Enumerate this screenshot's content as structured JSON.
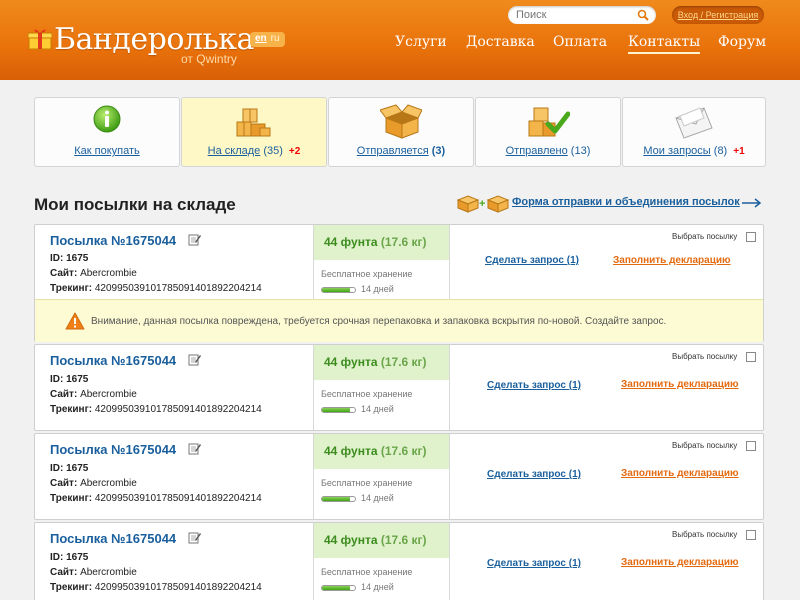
{
  "site": {
    "logo_text": "Бандеролька",
    "logo_subtitle": "от Qwintry",
    "lang_active": "en",
    "lang_other": "ru"
  },
  "header": {
    "search_placeholder": "Поиск",
    "login_label": "Вход / Регистрация",
    "nav": [
      "Услуги",
      "Доставка",
      "Оплата",
      "Контакты",
      "Форум"
    ],
    "nav_active": "Контакты"
  },
  "tabs": [
    {
      "label": "Как покупать",
      "count": "",
      "badge": "",
      "icon": "info-icon"
    },
    {
      "label": "На складе",
      "count": "(35)",
      "badge": "+2",
      "icon": "boxes-icon",
      "active": true
    },
    {
      "label": "Отправляется",
      "count": "(3)",
      "badge": "",
      "icon": "open-box-icon"
    },
    {
      "label": "Отправлено",
      "count": "(13)",
      "badge": "",
      "icon": "boxes-check-icon"
    },
    {
      "label": "Мои запросы",
      "count": "(8)",
      "badge": "+1",
      "icon": "envelope-icon"
    }
  ],
  "section": {
    "title": "Мои посылки на складе",
    "form_link": "Форма отправки и объединения посылок"
  },
  "parcels": [
    {
      "title": "Посылка №1675044",
      "id_label": "ID:",
      "id": "1675",
      "site_label": "Сайт:",
      "site": "Abercrombie",
      "tracking_label": "Трекинг:",
      "tracking": "420995039101785091401892204214",
      "weight_main": "44 фунта",
      "weight_kg": "(17.6 кг)",
      "storage": "Бесплатное хранение",
      "days": "14 дней",
      "storage_progress": 0.85,
      "request": "Сделать запрос (1)",
      "declaration": "Заполнить декларацию",
      "select": "Выбрать посылку",
      "warning": "Внимание, данная посылка повреждена, требуется срочная перепаковка и запаковка вскрытия по-новой. Создайте запрос."
    },
    {
      "title": "Посылка №1675044",
      "id_label": "ID:",
      "id": "1675",
      "site_label": "Сайт:",
      "site": "Abercrombie",
      "tracking_label": "Трекинг:",
      "tracking": "420995039101785091401892204214",
      "weight_main": "44 фунта",
      "weight_kg": "(17.6 кг)",
      "storage": "Бесплатное хранение",
      "days": "14 дней",
      "storage_progress": 0.85,
      "request": "Сделать запрос (1)",
      "declaration": "Заполнить декларацию",
      "select": "Выбрать посылку"
    },
    {
      "title": "Посылка №1675044",
      "id_label": "ID:",
      "id": "1675",
      "site_label": "Сайт:",
      "site": "Abercrombie",
      "tracking_label": "Трекинг:",
      "tracking": "420995039101785091401892204214",
      "weight_main": "44 фунта",
      "weight_kg": "(17.6 кг)",
      "storage": "Бесплатное хранение",
      "days": "14 дней",
      "storage_progress": 0.85,
      "request": "Сделать запрос (1)",
      "declaration": "Заполнить декларацию",
      "select": "Выбрать посылку"
    },
    {
      "title": "Посылка №1675044",
      "id_label": "ID:",
      "id": "1675",
      "site_label": "Сайт:",
      "site": "Abercrombie",
      "tracking_label": "Трекинг:",
      "tracking": "420995039101785091401892204214",
      "weight_main": "44 фунта",
      "weight_kg": "(17.6 кг)",
      "storage": "Бесплатное хранение",
      "days": "14 дней",
      "storage_progress": 0.85,
      "request": "Сделать запрос (1)",
      "declaration": "Заполнить декларацию",
      "select": "Выбрать посылку"
    }
  ],
  "colors": {
    "header_orange": "#e9720b",
    "link_blue": "#1a5f9d",
    "weight_green": "#3c8c1e",
    "declaration_orange": "#e46a10",
    "badge_red": "#ee0000",
    "warning_bg": "#fdfbd4"
  }
}
